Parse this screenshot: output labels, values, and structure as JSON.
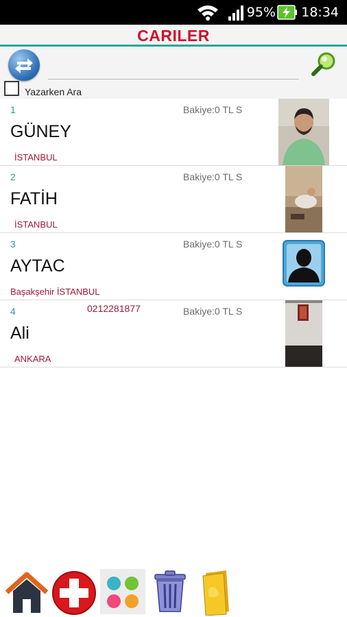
{
  "status_bar": {
    "battery_percent": "95%",
    "time": "18:34"
  },
  "header": {
    "title": "CARILER"
  },
  "search": {
    "placeholder": "",
    "type_to_search_label": "Yazarken Ara"
  },
  "customers": [
    {
      "number": "1",
      "name": "GÜNEY",
      "phone": "",
      "balance": "Bakiye:0 TL S",
      "city": "İSTANBUL"
    },
    {
      "number": "2",
      "name": "FATİH",
      "phone": "",
      "balance": "Bakiye:0 TL S",
      "city": "İSTANBUL"
    },
    {
      "number": "3",
      "name": "AYTAC",
      "phone": "",
      "balance": "Bakiye:0 TL S",
      "city": "Başakşehir  İSTANBUL"
    },
    {
      "number": "4",
      "name": "Ali",
      "phone": "0212281877",
      "balance": "Bakiye:0 TL S",
      "city": "ANKARA"
    }
  ],
  "icons": {
    "refresh": "refresh-icon",
    "search": "magnifier-icon",
    "home": "home-icon",
    "add": "add-icon",
    "apps": "apps-grid-icon",
    "delete": "trash-icon",
    "folder": "folder-icon"
  },
  "colors": {
    "title": "#d0102e",
    "accent_line": "#2aa69a",
    "row_number": "#2a9c90",
    "city_text": "#a0173a"
  }
}
